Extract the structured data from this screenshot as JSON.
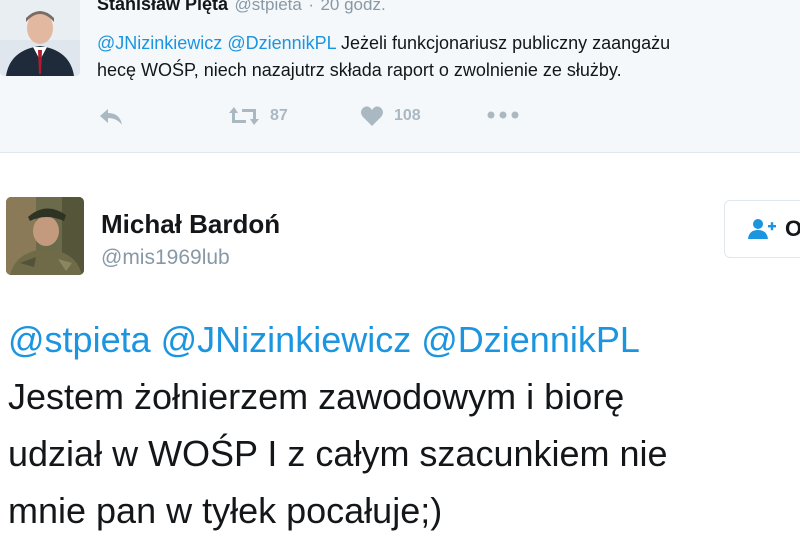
{
  "top_tweet": {
    "author_name": "Stanisław Pięta",
    "author_handle": "@stpieta",
    "separator": "·",
    "time": "20 godz.",
    "mentions": [
      "@JNizinkiewicz",
      "@DziennikPL"
    ],
    "text_line1_rest": "Jeżeli funkcjonariusz publiczny zaangażu",
    "text_line2": "hecę WOŚP, niech nazajutrz składa raport o zwolnienie ze służby.",
    "retweet_count": "87",
    "like_count": "108"
  },
  "tweet": {
    "author_name": "Michał Bardoń",
    "author_handle": "@mis1969lub",
    "follow_label": "O",
    "mentions": [
      "@stpieta",
      "@JNizinkiewicz",
      "@DziennikPL"
    ],
    "lines": [
      "Jestem żołnierzem zawodowym i biorę",
      "udział w WOŚP I z całym szacunkiem nie",
      "mnie pan w tyłek pocałuje;)"
    ]
  },
  "colors": {
    "link": "#1b95e0",
    "muted": "#8899a6",
    "icon": "#aab8c2",
    "top_bg": "#f5f8fa"
  },
  "icons": [
    "reply-icon",
    "retweet-icon",
    "heart-icon",
    "more-icon",
    "follow-person-icon"
  ]
}
